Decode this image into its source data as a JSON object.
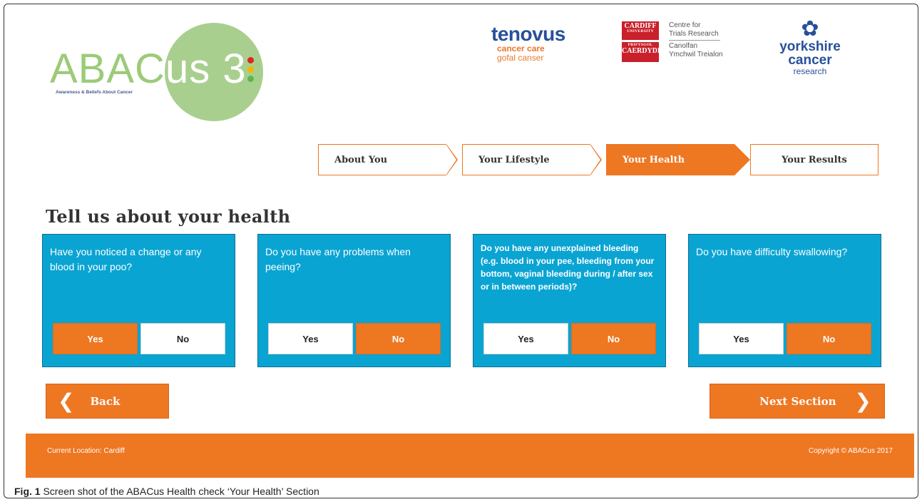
{
  "logo": {
    "main_green": "ABAC",
    "main_white": "us 3",
    "subtitle": "Awareness & Beliefs About Cancer",
    "dot_colors": [
      "#e02424",
      "#f2b705",
      "#5fb648"
    ]
  },
  "partners": {
    "tenovus": {
      "name": "tenovus",
      "line1": "cancer care",
      "line2": "gofal canser"
    },
    "cardiff": {
      "crest_top": "CARDIFF",
      "crest_top_small": "UNIVERSITY",
      "crest_bottom_small": "PRIFYSGOL",
      "crest_bottom": "CAERDYDD",
      "en_line1": "Centre for",
      "en_line2": "Trials Research",
      "cy_line1": "Canolfan",
      "cy_line2": "Ymchwil Treialon"
    },
    "yorkshire": {
      "line1": "yorkshire cancer",
      "line2": "research"
    }
  },
  "steps": [
    {
      "label": "About You",
      "active": false
    },
    {
      "label": "Your Lifestyle",
      "active": false
    },
    {
      "label": "Your Health",
      "active": true
    },
    {
      "label": "Your Results",
      "active": false
    }
  ],
  "heading": "Tell us about your health",
  "questions": [
    {
      "text": "Have you noticed a change or any blood in your poo?",
      "yes": "Yes",
      "no": "No",
      "selected": "yes"
    },
    {
      "text": "Do you have any problems when peeing?",
      "yes": "Yes",
      "no": "No",
      "selected": "no"
    },
    {
      "text": "Do you have any unexplained bleeding (e.g. blood in your pee, bleeding from your bottom, vaginal bleeding during / after sex or in between periods)?",
      "yes": "Yes",
      "no": "No",
      "selected": "no"
    },
    {
      "text": "Do you have difficulty swallowing?",
      "yes": "Yes",
      "no": "No",
      "selected": "no"
    }
  ],
  "nav": {
    "back": "Back",
    "next": "Next Section"
  },
  "footer": {
    "location": "Current Location: Cardiff",
    "copyright": "Copyright © ABACus 2017"
  },
  "caption": {
    "fig": "Fig. 1",
    "text": "Screen shot of the ABACus Health check ‘Your Health’ Section"
  },
  "colors": {
    "accent": "#ee7722",
    "card": "#0aa4d3",
    "logo_green": "#9ccb78"
  }
}
